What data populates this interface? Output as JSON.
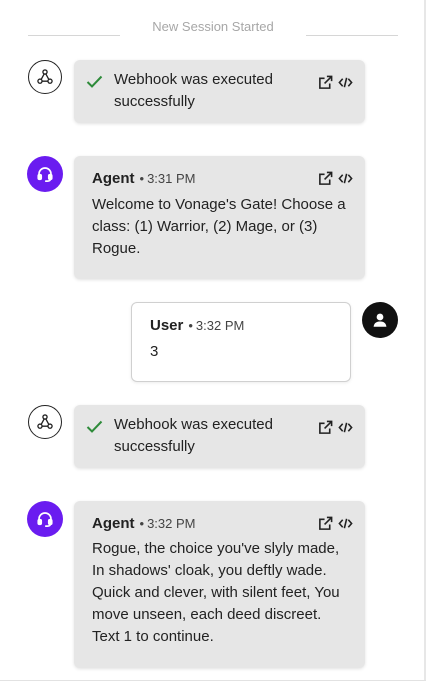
{
  "session": {
    "label": "New Session Started"
  },
  "messages": [
    {
      "type": "webhook",
      "text": "Webhook was executed successfully"
    },
    {
      "type": "agent",
      "sender": "Agent",
      "time": "3:31 PM",
      "text": "Welcome to Vonage's Gate! Choose a class: (1) Warrior, (2) Mage, or (3) Rogue."
    },
    {
      "type": "user",
      "sender": "User",
      "time": "3:32 PM",
      "text": "3"
    },
    {
      "type": "webhook",
      "text": "Webhook was executed successfully"
    },
    {
      "type": "agent",
      "sender": "Agent",
      "time": "3:32 PM",
      "text": "Rogue, the choice you've slyly made, In shadows' cloak, you deftly wade. Quick and clever, with silent feet, You move unseen, each deed discreet. Text 1 to continue."
    }
  ],
  "icons": {
    "webhook": "webhook-icon",
    "agent": "headset-icon",
    "user": "user-icon",
    "check": "check-icon",
    "open": "external-link-icon",
    "code": "code-icon"
  },
  "colors": {
    "agent_avatar": "#6a1cf0",
    "check": "#2e8b3a",
    "bubble_bg": "#e6e6e6"
  }
}
